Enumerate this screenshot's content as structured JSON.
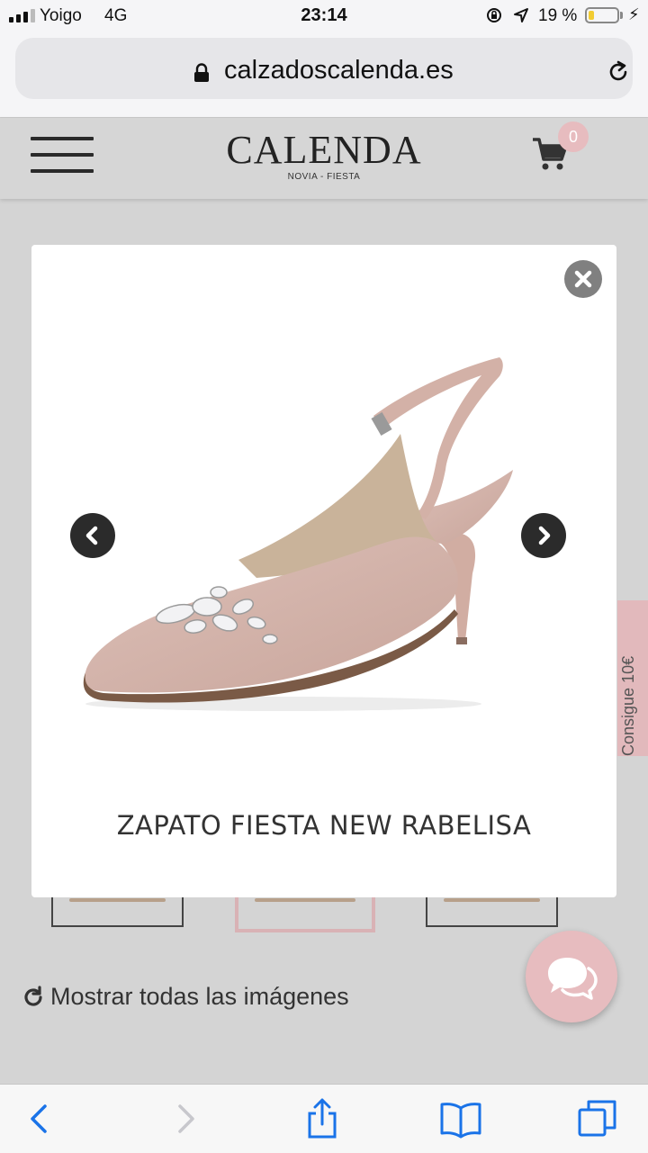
{
  "status_bar": {
    "carrier": "Yoigo",
    "network": "4G",
    "time": "23:14",
    "battery_percent": "19 %",
    "battery_level": 0.19,
    "battery_color": "#f2cc32"
  },
  "browser": {
    "url": "calzadoscalenda.es",
    "icons": [
      "lock-icon",
      "reload-icon"
    ]
  },
  "site_header": {
    "logo": "CALENDA",
    "logo_subtitle": "NOVIA - FIESTA",
    "cart_count": "0",
    "accent_color": "#e7bcbf"
  },
  "modal": {
    "product_title": "ZAPATO FIESTA NEW RABELISA",
    "icons": [
      "close-icon",
      "chevron-left-icon",
      "chevron-right-icon"
    ]
  },
  "page": {
    "show_all_images": "Mostrar todas las imágenes",
    "side_tab_label": "Consigue 10€"
  },
  "toolbar": {
    "icons": [
      "back-icon",
      "forward-icon",
      "share-icon",
      "bookmarks-icon",
      "tabs-icon"
    ]
  }
}
